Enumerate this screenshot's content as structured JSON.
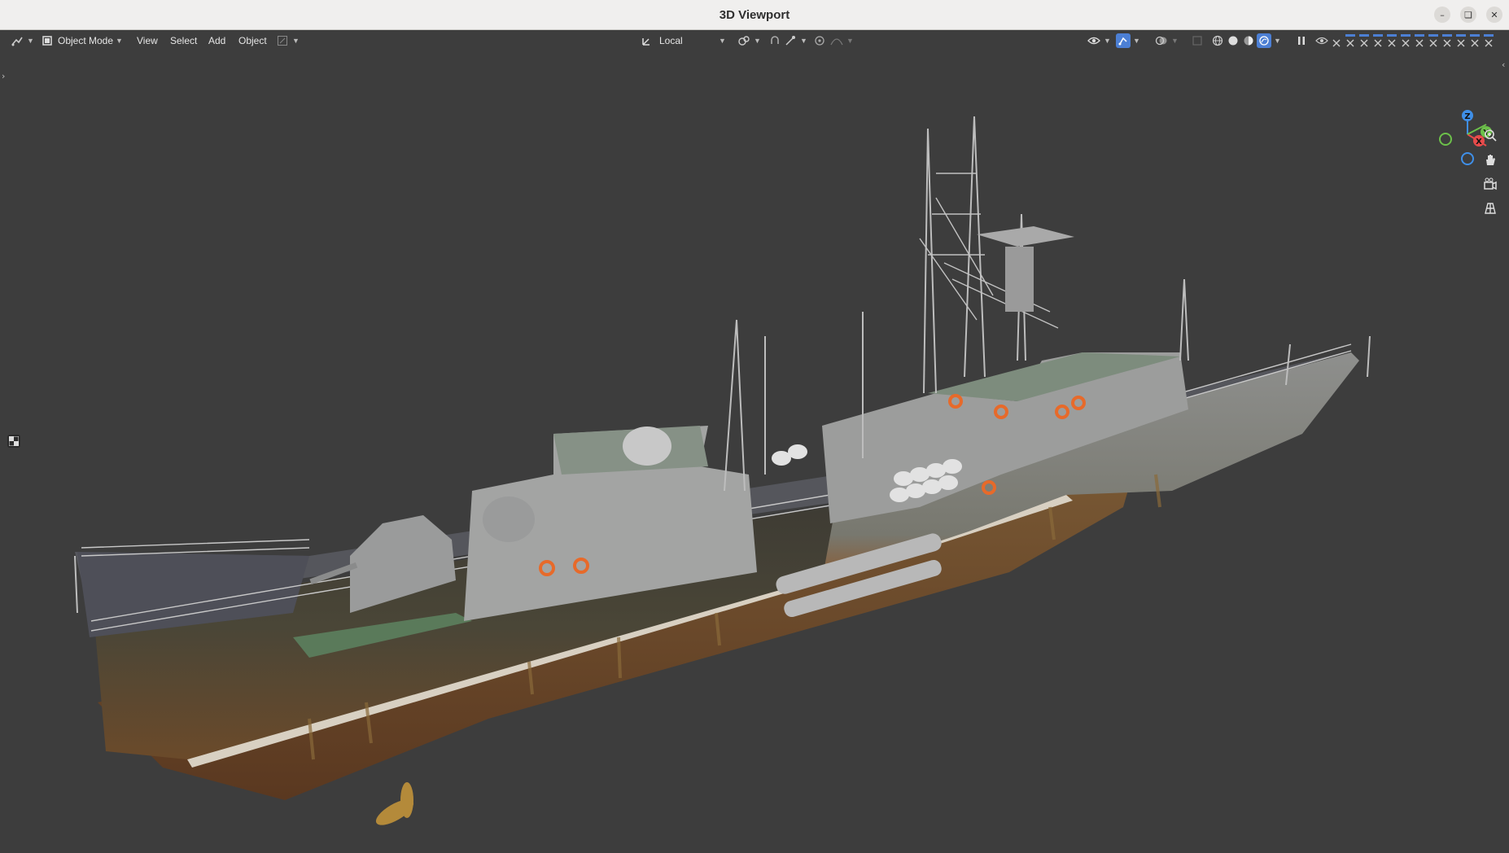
{
  "window": {
    "title": "3D Viewport"
  },
  "header": {
    "mode_label": "Object Mode",
    "menus": [
      "View",
      "Select",
      "Add",
      "Object"
    ],
    "transform_orientation": "Local"
  },
  "gizmo": {
    "x_label": "X",
    "y_label": "Y",
    "z_label": "Z"
  },
  "icons": {
    "editor_type": "editor-type-icon",
    "mode": "object-mode-icon",
    "orientation": "transform-orientation-icon",
    "pivot": "pivot-point-icon",
    "snap": "snap-icon",
    "proportional": "proportional-edit-icon",
    "visibility": "visibility-icon",
    "gizmo_toggle": "gizmo-icon",
    "overlays": "overlays-icon",
    "shading": [
      "wireframe-shading-icon",
      "solid-shading-icon",
      "material-shading-icon",
      "rendered-shading-icon"
    ],
    "nav": [
      "zoom-icon",
      "pan-hand-icon",
      "camera-icon",
      "grid-view-icon"
    ]
  },
  "colors": {
    "accent": "#4c9aff",
    "axis_x": "#e84b4b",
    "axis_y": "#6cc04a",
    "axis_z": "#3f8fe8"
  }
}
